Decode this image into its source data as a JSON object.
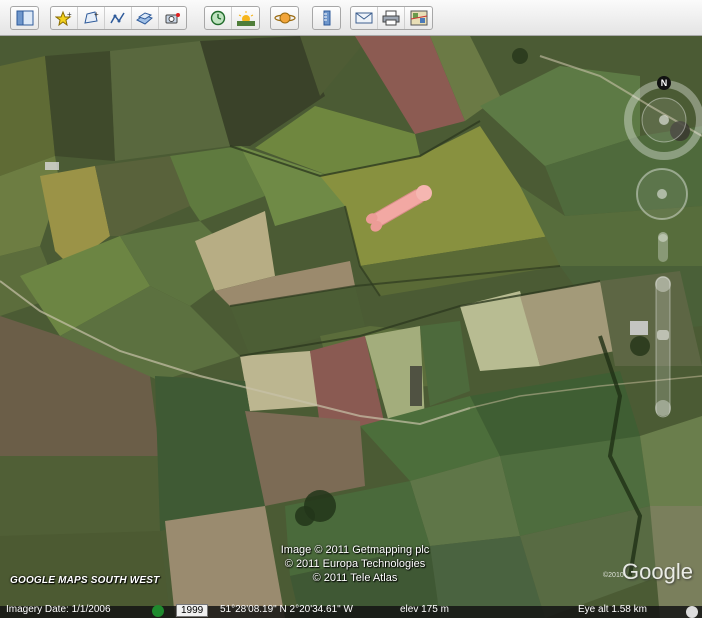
{
  "toolbar": {
    "groups": [
      {
        "id": "sidebar",
        "buttons": [
          {
            "icon": "sidebar-icon"
          }
        ]
      },
      {
        "id": "add",
        "buttons": [
          {
            "icon": "placemark-icon"
          },
          {
            "icon": "polygon-icon"
          },
          {
            "icon": "path-icon"
          },
          {
            "icon": "image-overlay-icon"
          },
          {
            "icon": "record-tour-icon"
          }
        ]
      },
      {
        "id": "view",
        "buttons": [
          {
            "icon": "historical-imagery-icon"
          },
          {
            "icon": "sunlight-icon"
          }
        ]
      },
      {
        "id": "planet",
        "buttons": [
          {
            "icon": "planet-icon"
          }
        ]
      },
      {
        "id": "ruler",
        "buttons": [
          {
            "icon": "ruler-icon"
          }
        ]
      },
      {
        "id": "share",
        "buttons": [
          {
            "icon": "email-icon"
          },
          {
            "icon": "print-icon"
          },
          {
            "icon": "view-in-maps-icon"
          }
        ]
      }
    ]
  },
  "map": {
    "credits": [
      "Image © 2011 Getmapping plc",
      "© 2011 Europa Technologies",
      "© 2011 Tele Atlas"
    ],
    "watermark": "GOOGLE MAPS SOUTH WEST",
    "logo": "Google",
    "logo_year": "©2010",
    "compass_label": "N"
  },
  "status": {
    "imagery_date": "Imagery Date: 1/1/2006",
    "history_year": "1999",
    "coordinates": "51°28'08.19\" N    2°20'34.61\" W",
    "elevation": "elev  175 m",
    "eye_alt": "Eye alt    1.58 km"
  },
  "colors": {
    "toolbar_bg": "#f2f2f2",
    "field_dark": "#3f4b2c",
    "field_light": "#b9b58c",
    "field_red": "#8c5b52",
    "object_pink": "#f2a8a3"
  }
}
